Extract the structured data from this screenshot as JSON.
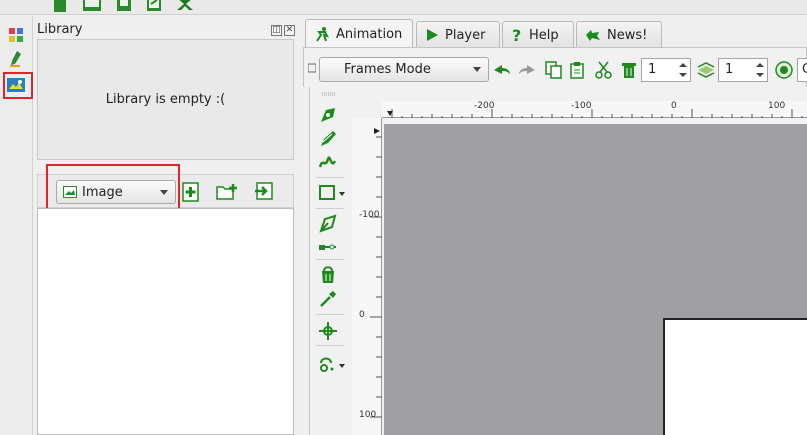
{
  "library": {
    "title": "Library",
    "empty_text": "Library is empty :(",
    "type_combo": "Image",
    "float_btn": "◫",
    "close_btn": "✕"
  },
  "tabs": [
    {
      "label": "Animation",
      "icon": "animation-icon"
    },
    {
      "label": "Player",
      "icon": "play-icon"
    },
    {
      "label": "Help",
      "icon": "help-icon"
    },
    {
      "label": "News!",
      "icon": "news-icon"
    }
  ],
  "toolbar": {
    "mode": "Frames Mode",
    "spin1": "1",
    "spin2": "1",
    "cut_text": "C"
  },
  "rulers": {
    "h": [
      "-200",
      "-100",
      "0",
      "100"
    ],
    "v": [
      "-100",
      "0",
      "100"
    ]
  },
  "colors": {
    "accent": "#1e8a1e",
    "highlight": "#e0262b",
    "canvas_bg": "#a0a0a4"
  }
}
